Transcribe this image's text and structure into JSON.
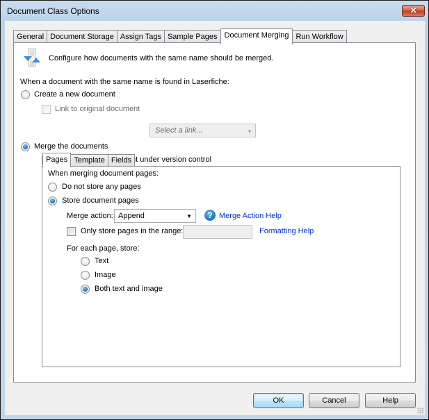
{
  "window": {
    "title": "Document Class Options",
    "close_icon": "close-icon"
  },
  "tabs": [
    {
      "label": "General",
      "active": false
    },
    {
      "label": "Document Storage",
      "active": false
    },
    {
      "label": "Assign Tags",
      "active": false
    },
    {
      "label": "Sample Pages",
      "active": false
    },
    {
      "label": "Document Merging",
      "active": true
    },
    {
      "label": "Run Workflow",
      "active": false
    }
  ],
  "merging": {
    "icon": "merge-documents-icon",
    "description": "Configure how documents with the same name should be merged.",
    "prompt": "When a document with the same name is found in Laserfiche:",
    "create_new": {
      "label": "Create a new document",
      "checked": false
    },
    "link_original": {
      "label": "Link to original document",
      "checked": false,
      "enabled": false
    },
    "link_select": {
      "placeholder": "Select a link...",
      "enabled": false
    },
    "merge_docs": {
      "label": "Merge the documents",
      "checked": true
    },
    "version_control": {
      "label": "Place existing document under version control",
      "checked": false
    }
  },
  "inner_tabs": [
    {
      "label": "Pages",
      "active": true
    },
    {
      "label": "Template",
      "active": false
    },
    {
      "label": "Fields",
      "active": false
    }
  ],
  "pages": {
    "prompt": "When merging document pages:",
    "no_store": {
      "label": "Do not store any pages",
      "checked": false
    },
    "store": {
      "label": "Store document pages",
      "checked": true
    },
    "merge_action_label": "Merge action:",
    "merge_action_value": "Append",
    "merge_action_help": "Merge Action Help",
    "range_label": "Only store pages in the range:",
    "range_checked": false,
    "range_value": "",
    "formatting_help": "Formatting Help",
    "per_page_label": "For each page, store:",
    "store_options": [
      {
        "label": "Text",
        "checked": false
      },
      {
        "label": "Image",
        "checked": false
      },
      {
        "label": "Both text and image",
        "checked": true
      }
    ]
  },
  "buttons": {
    "ok": "OK",
    "cancel": "Cancel",
    "help": "Help"
  }
}
